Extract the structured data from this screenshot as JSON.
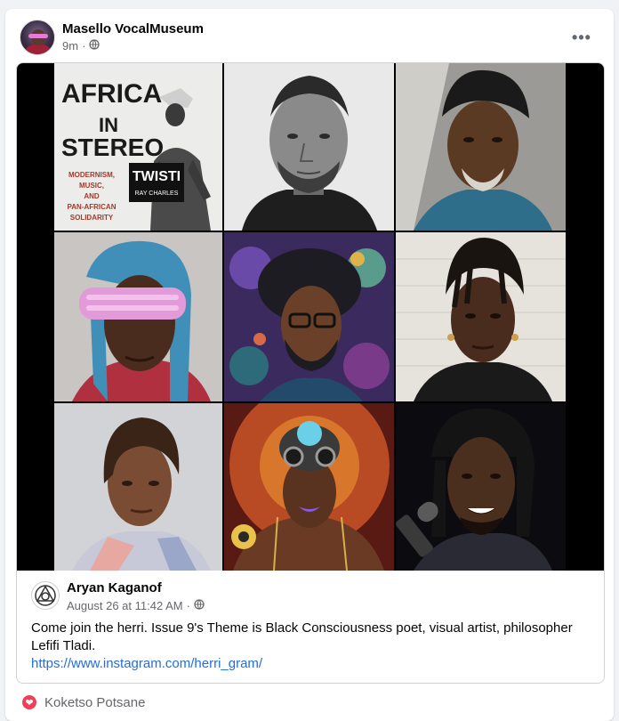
{
  "post": {
    "author": "Masello VocalMuseum",
    "time": "9m",
    "dot": "·",
    "audience_icon": "globe-icon",
    "more_label": "•••"
  },
  "collage": {
    "tile1": {
      "title_line1": "AFRICA",
      "title_line2": "IN",
      "title_line3": "STEREO",
      "subtitle_line1": "MODERNISM,",
      "subtitle_line2": "MUSIC,",
      "subtitle_line3": "AND",
      "subtitle_line4": "PAN-AFRICAN",
      "subtitle_line5": "SOLIDARITY",
      "sign_text": "TWISTI",
      "sign_sub": "RAY CHARLES"
    }
  },
  "shared_post": {
    "author": "Aryan Kaganof",
    "date": "August 26 at 11:42 AM",
    "dot": "·",
    "text": "Come join the herri. Issue 9's Theme is Black Consciousness poet, visual artist, philosopher Lefifi Tladi.",
    "link": "https://www.instagram.com/herri_gram/"
  },
  "reactions": {
    "icon": "heart-icon",
    "name": "Koketso Potsane"
  },
  "colors": {
    "link": "#216fdb",
    "love": "#f33e58",
    "meta": "#65676b"
  }
}
